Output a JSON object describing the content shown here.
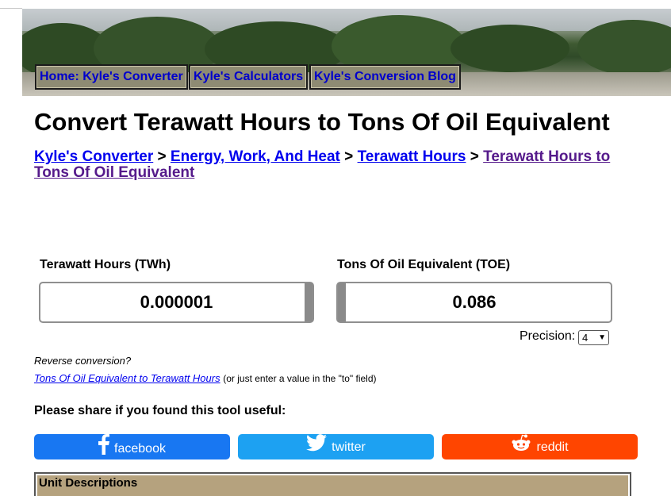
{
  "nav": {
    "home": "Home: Kyle's Converter",
    "calculators": "Kyle's Calculators",
    "blog": "Kyle's Conversion Blog"
  },
  "page_title": "Convert Terawatt Hours to Tons Of Oil Equivalent",
  "breadcrumb": {
    "items": [
      "Kyle's Converter",
      "Energy, Work, And Heat",
      "Terawatt Hours",
      "Terawatt Hours to Tons Of Oil Equivalent"
    ],
    "separator": ">"
  },
  "converter": {
    "from_label": "Terawatt Hours (TWh)",
    "from_value": "0.000001",
    "to_label": "Tons Of Oil Equivalent (TOE)",
    "to_value": "0.086",
    "precision_label": "Precision:",
    "precision_value": "4"
  },
  "reverse": {
    "question": "Reverse conversion?",
    "link": "Tons Of Oil Equivalent to Terawatt Hours",
    "note": "(or just enter a value in the \"to\" field)"
  },
  "share": {
    "title": "Please share if you found this tool useful:",
    "facebook": "facebook",
    "twitter": "twitter",
    "reddit": "reddit"
  },
  "units_heading": "Unit Descriptions",
  "colors": {
    "facebook": "#1877f2",
    "twitter": "#1da1f2",
    "reddit": "#ff4500",
    "nav_button": "#8e8b73",
    "units_header": "#b5a27e"
  },
  "icons": {
    "facebook": "facebook-icon",
    "twitter": "twitter-icon",
    "reddit": "reddit-icon",
    "select": "chevron-down-icon"
  }
}
